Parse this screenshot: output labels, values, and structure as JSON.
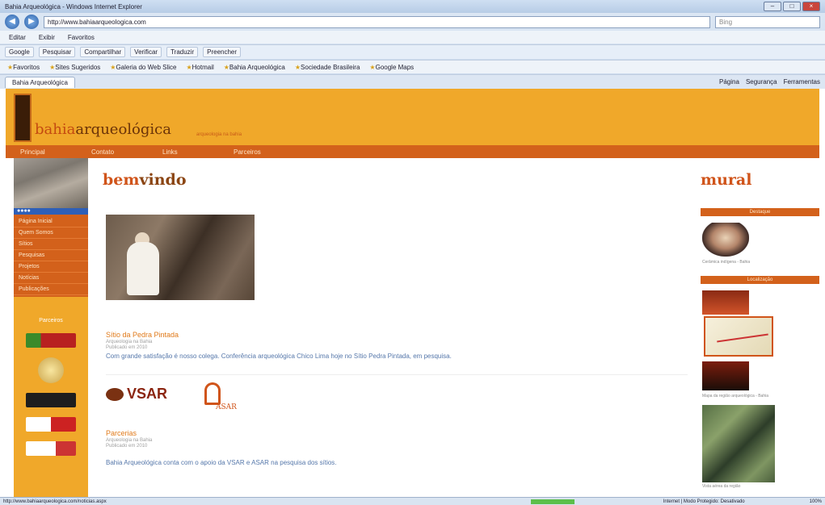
{
  "browser": {
    "title": "Bahia Arqueológica - Windows Internet Explorer",
    "address": "http://www.bahiaarqueologica.com",
    "search_placeholder": "Bing",
    "menu": [
      "Editar",
      "Exibir",
      "Favoritos"
    ],
    "toolbar": [
      "Google",
      "Pesquisar",
      "Compartilhar",
      "Verificar",
      "Traduzir",
      "Preencher"
    ],
    "favorites_label": "Favoritos",
    "favorites": [
      "Sites Sugeridos",
      "Galeria do Web Slice",
      "Hotmail",
      "Bahia Arqueológica",
      "Sociedade Brasileira",
      "Google Maps"
    ],
    "tab": "Bahia Arqueológica",
    "tab_tools": [
      "Página",
      "Segurança",
      "Ferramentas"
    ],
    "window_buttons": [
      "–",
      "□",
      "×"
    ],
    "status_text": "http://www.bahiaarqueologica.com/noticias.aspx",
    "status_zone": "Internet | Modo Protegido: Desativado",
    "zoom": "100%"
  },
  "site": {
    "logo_prefix": "bahia",
    "logo_suffix": "arqueológica",
    "tagline": "arqueologia na bahia",
    "nav": [
      "Principal",
      "Contato",
      "Links",
      "Parceiros"
    ],
    "left_menu_head": "●●●●",
    "left_menu": [
      "Página Inicial",
      "Quem Somos",
      "Sítios",
      "Pesquisas",
      "Projetos",
      "Notícias",
      "Publicações"
    ],
    "partners_title": "Parceiros",
    "welcome_a": "bem",
    "welcome_b": "vindo",
    "news": [
      {
        "title": "Sítio da Pedra Pintada",
        "meta1": "Arqueologia na Bahia",
        "meta2": "Publicado em 2010",
        "body": "Com grande satisfação é nosso colega. Conferência arqueológica Chico Lima hoje no Sítio Pedra Pintada, em pesquisa."
      },
      {
        "title": "Parcerias",
        "meta1": "Arqueologia na Bahia",
        "meta2": "Publicado em 2010",
        "body": "Bahia Arqueológica conta com o apoio da VSAR e ASAR na pesquisa dos sítios."
      }
    ],
    "vsar": "VSAR",
    "asar": "ASAR",
    "mural_title": "mural",
    "right_head1": "Destaque",
    "right_caption1": "Cerâmica indígena - Bahia",
    "right_head2": "Localização",
    "right_caption2": "Mapa da região arqueológica - Bahia",
    "right_caption3": "Vista aérea da região"
  }
}
